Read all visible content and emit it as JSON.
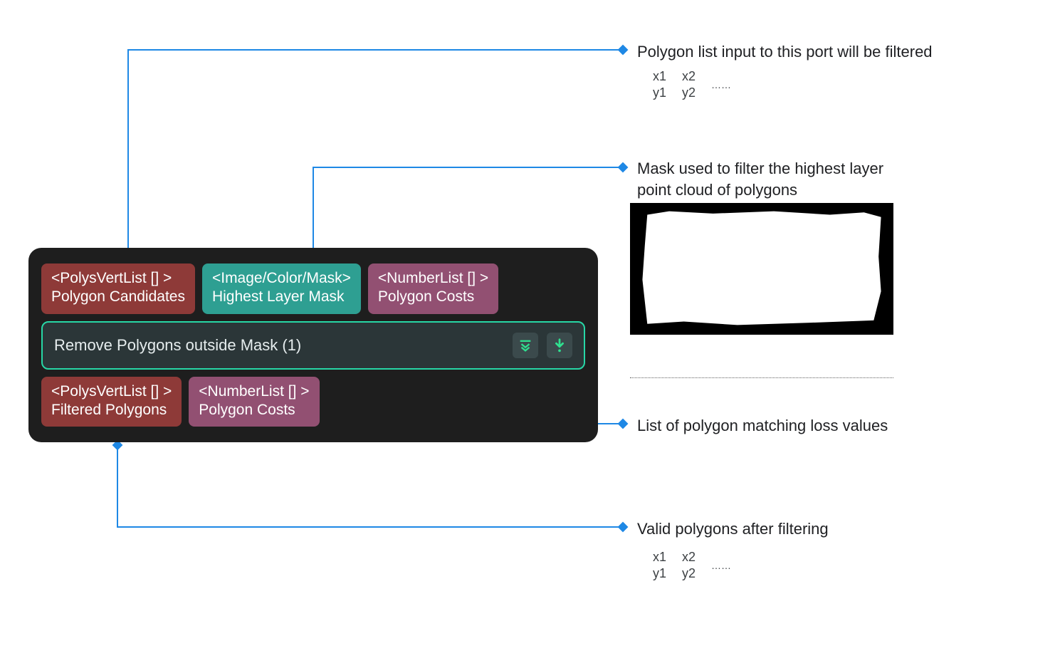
{
  "node": {
    "title": "Remove Polygons outside Mask (1)",
    "inputs": [
      {
        "type": "<PolysVertList [] >",
        "label": "Polygon Candidates",
        "color": "red"
      },
      {
        "type": "<Image/Color/Mask>",
        "label": "Highest Layer Mask",
        "color": "teal"
      },
      {
        "type": "<NumberList [] >",
        "label": "Polygon Costs",
        "color": "plum"
      }
    ],
    "outputs": [
      {
        "type": "<PolysVertList [] >",
        "label": "Filtered Polygons",
        "color": "red"
      },
      {
        "type": "<NumberList [] >",
        "label": "Polygon Costs",
        "color": "plum"
      }
    ]
  },
  "annotations": {
    "a1": "Polygon list input to this port will be filtered",
    "a2": "Mask used to filter the highest layer point cloud of polygons",
    "a3": "List of polygon matching loss values",
    "a4": "Valid polygons after filtering"
  },
  "matrix": {
    "r1c1": "x1",
    "r1c2": "x2",
    "r2c1": "y1",
    "r2c2": "y2",
    "dots": "……"
  },
  "colors": {
    "leader": "#1E88E5",
    "accent": "#27D7A6"
  }
}
